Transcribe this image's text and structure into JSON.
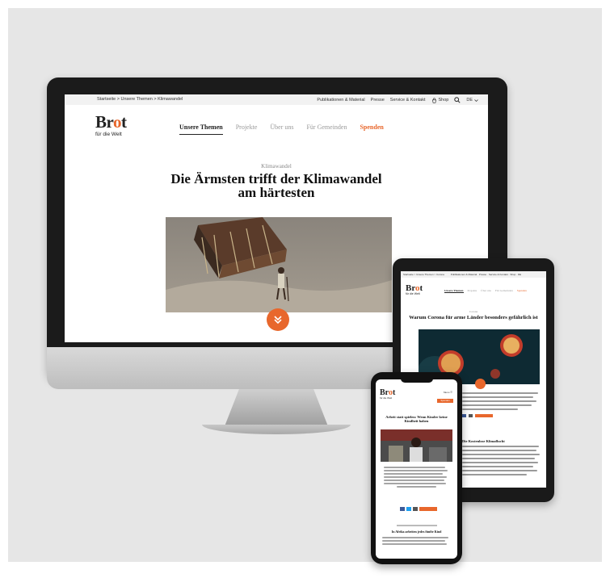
{
  "desktop": {
    "breadcrumb": "Startseite > Unsere Themen > Klimawandel",
    "utility": [
      "Publikationen & Material",
      "Presse",
      "Service & Kontakt",
      "Shop"
    ],
    "language": "DE",
    "logo_main": "Brot",
    "logo_sub": "für die Welt",
    "nav": [
      "Unsere Themen",
      "Projekte",
      "Über uns",
      "Für Gemeinden",
      "Spenden"
    ],
    "kicker": "Klimawandel",
    "headline_line1": "Die Ärmsten trifft der Klimawandel",
    "headline_line2": "am härtesten"
  },
  "tablet": {
    "breadcrumb": "Startseite > Unsere Themen > Corona",
    "utility": "Publikationen & Material · Presse · Service & Kontakt · Shop · DE",
    "logo_main": "Brot",
    "logo_sub": "für die Welt",
    "nav": [
      "Unsere Themen",
      "Projekte",
      "Über uns",
      "Für Gemeinden",
      "Spenden"
    ],
    "kicker": "Corona",
    "headline": "Warum Corona für arme Länder besonders gefährlich ist",
    "section": "Die Kostenlose Klimaflucht"
  },
  "phone": {
    "logo_main": "Brot",
    "logo_sub": "für die Welt",
    "menu": "Menu",
    "donate": "Spenden",
    "headline": "Arbeit statt spielen: Wenn Kinder keine Kindheit haben",
    "section": "In Afrika arbeiten jedes fünfte Kind"
  },
  "colors": {
    "accent": "#e8672c",
    "ink": "#111111",
    "bezel": "#1b1b1b",
    "backdrop": "#e6e6e6"
  },
  "icons": [
    "shop-icon",
    "search-icon",
    "chevron-down-icon",
    "chevron-double-down-icon",
    "hamburger-icon"
  ]
}
